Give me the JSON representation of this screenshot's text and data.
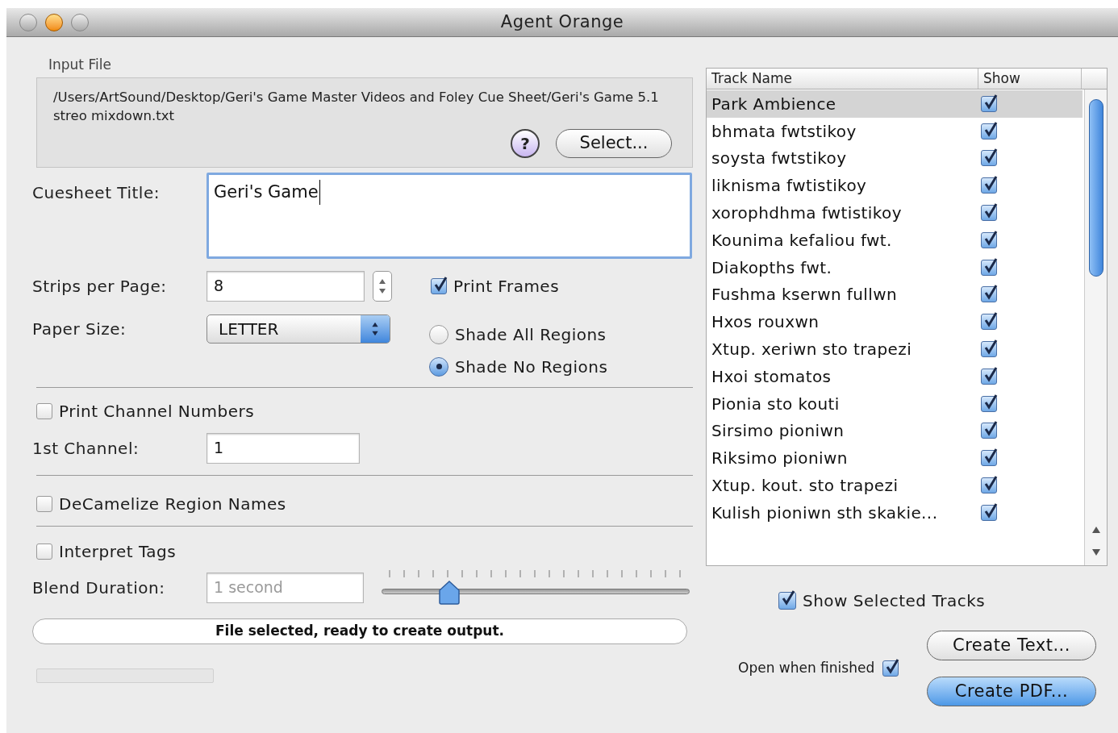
{
  "window": {
    "title": "Agent Orange"
  },
  "input_file": {
    "label": "Input File",
    "path": "/Users/ArtSound/Desktop/Geri's Game Master Videos and Foley Cue Sheet/Geri's Game 5.1 streo mixdown.txt",
    "help": "?",
    "select": "Select..."
  },
  "cuesheet_title": {
    "label": "Cuesheet Title:",
    "value": "Geri's Game"
  },
  "strips_per_page": {
    "label": "Strips per Page:",
    "value": "8"
  },
  "print_frames": {
    "label": "Print Frames",
    "checked": true
  },
  "paper_size": {
    "label": "Paper Size:",
    "value": "LETTER"
  },
  "shading": [
    {
      "label": "Shade All Regions",
      "selected": false
    },
    {
      "label": "Shade No Regions",
      "selected": true
    }
  ],
  "print_channel_numbers": {
    "label": "Print Channel Numbers",
    "checked": false
  },
  "first_channel": {
    "label": "1st Channel:",
    "value": "1"
  },
  "decamelize": {
    "label": "DeCamelize Region Names",
    "checked": false
  },
  "interpret_tags": {
    "label": "Interpret Tags",
    "checked": false
  },
  "blend_duration": {
    "label": "Blend Duration:",
    "value": "1 second",
    "disabled": true,
    "level": 0.22
  },
  "status": "File selected, ready to create output.",
  "progress": {
    "level": 0
  },
  "tracks": {
    "columns": [
      "Track Name",
      "Show"
    ],
    "rows": [
      {
        "name": "Park Ambience",
        "show": true,
        "selected": true
      },
      {
        "name": "bhmata fwtstikoy",
        "show": true,
        "selected": false
      },
      {
        "name": "soysta fwtstikoy",
        "show": true,
        "selected": false
      },
      {
        "name": "liknisma fwtistikoy",
        "show": true,
        "selected": false
      },
      {
        "name": "xorophdhma fwtistikoy",
        "show": true,
        "selected": false
      },
      {
        "name": "Kounima kefaliou fwt.",
        "show": true,
        "selected": false
      },
      {
        "name": "Diakopths fwt.",
        "show": true,
        "selected": false
      },
      {
        "name": "Fushma kserwn fullwn",
        "show": true,
        "selected": false
      },
      {
        "name": "Hxos rouxwn",
        "show": true,
        "selected": false
      },
      {
        "name": "Xtup. xeriwn sto trapezi",
        "show": true,
        "selected": false
      },
      {
        "name": "Hxoi stomatos",
        "show": true,
        "selected": false
      },
      {
        "name": "Pionia sto kouti",
        "show": true,
        "selected": false
      },
      {
        "name": "Sirsimo pioniwn",
        "show": true,
        "selected": false
      },
      {
        "name": "Riksimo pioniwn",
        "show": true,
        "selected": false
      },
      {
        "name": "Xtup. kout. sto trapezi",
        "show": true,
        "selected": false
      },
      {
        "name": "Kulish pioniwn sth skakie...",
        "show": true,
        "selected": false
      }
    ]
  },
  "show_selected_tracks": {
    "label": "Show Selected Tracks",
    "checked": true
  },
  "open_when_finished": {
    "label": "Open when finished",
    "checked": true
  },
  "buttons": [
    {
      "label": "Create Text...",
      "default": false
    },
    {
      "label": "Create PDF...",
      "default": true
    }
  ]
}
